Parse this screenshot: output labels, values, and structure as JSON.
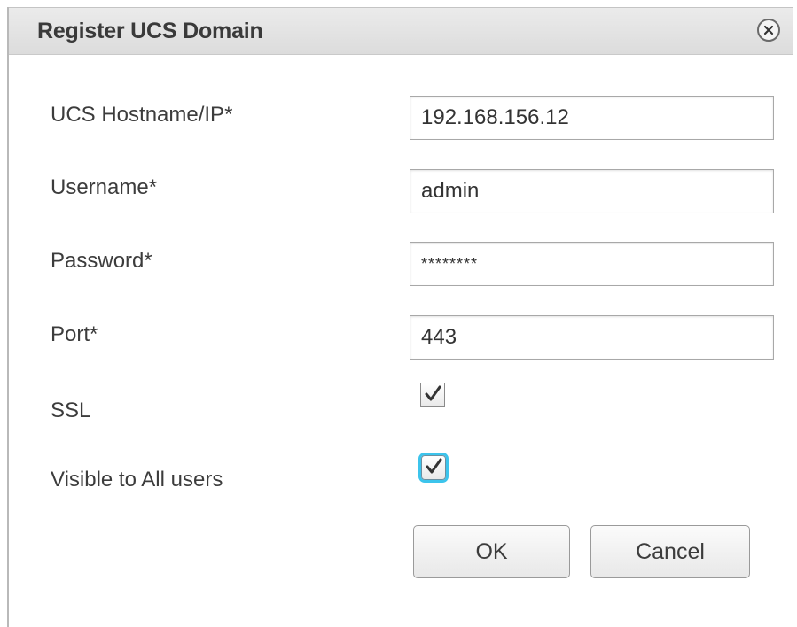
{
  "dialog": {
    "title": "Register UCS Domain",
    "close_icon": "close-icon"
  },
  "form": {
    "hostname": {
      "label": "UCS Hostname/IP*",
      "value": "192.168.156.12"
    },
    "username": {
      "label": "Username*",
      "value": "admin"
    },
    "password": {
      "label": "Password*",
      "value": "********"
    },
    "port": {
      "label": "Port*",
      "value": "443"
    },
    "ssl": {
      "label": "SSL",
      "checked": true
    },
    "visible_all": {
      "label": "Visible to All users",
      "checked": true,
      "focused": true
    }
  },
  "buttons": {
    "ok_label": "OK",
    "cancel_label": "Cancel"
  },
  "colors": {
    "focus_ring": "#3cc4ec",
    "titlebar": "#e2e2e2"
  }
}
